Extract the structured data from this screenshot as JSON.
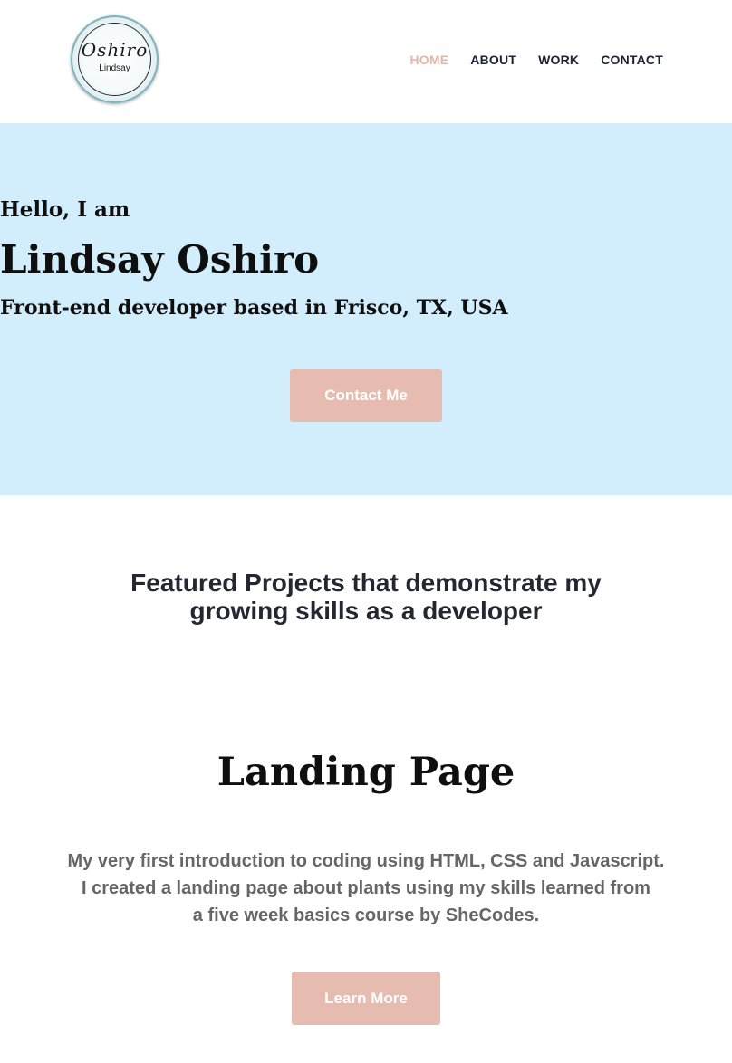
{
  "header": {
    "logo": {
      "script_text": "Oshiro",
      "sub_text": "Lindsay"
    },
    "nav": [
      {
        "label": "HOME",
        "active": true
      },
      {
        "label": "ABOUT",
        "active": false
      },
      {
        "label": "WORK",
        "active": false
      },
      {
        "label": "CONTACT",
        "active": false
      }
    ]
  },
  "hero": {
    "greeting": "Hello, I am",
    "name": "Lindsay Oshiro",
    "tagline": "Front-end developer based in Frisco, TX, USA",
    "cta_label": "Contact Me"
  },
  "featured": {
    "heading_line1": "Featured Projects that demonstrate my",
    "heading_line2": "growing skills as a developer"
  },
  "project": {
    "title": "Landing Page",
    "description_line1": "My very first introduction to coding using HTML, CSS and Javascript.",
    "description_line2": "I created a landing page about plants using my skills learned from",
    "description_line3": "a five week basics course by SheCodes.",
    "button_label": "Learn More"
  },
  "colors": {
    "hero_bg": "#d2edfb",
    "accent": "#e6bcb0",
    "nav_active": "#e4b5aa",
    "nav_text": "#1e2236"
  }
}
